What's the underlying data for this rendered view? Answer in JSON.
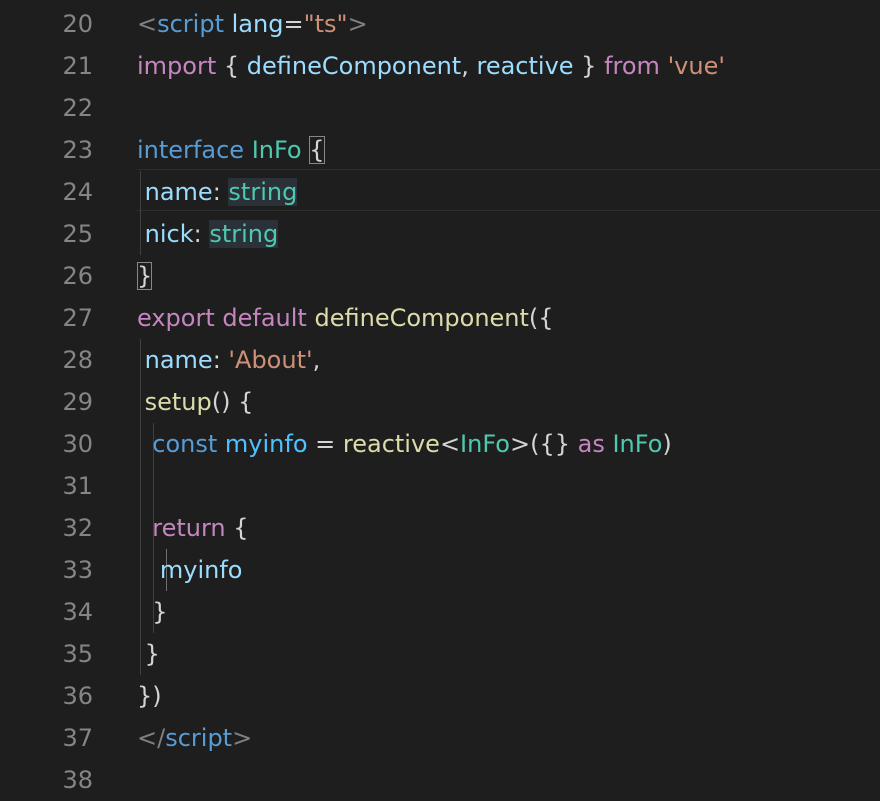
{
  "editor": {
    "lines": [
      {
        "n": "20",
        "tokens": [
          {
            "t": "<",
            "c": "#808080"
          },
          {
            "t": "script",
            "c": "#569cd6"
          },
          {
            "t": " ",
            "c": "#d4d4d4"
          },
          {
            "t": "lang",
            "c": "#9cdcfe"
          },
          {
            "t": "=",
            "c": "#d4d4d4"
          },
          {
            "t": "\"ts\"",
            "c": "#ce9178"
          },
          {
            "t": ">",
            "c": "#808080"
          }
        ]
      },
      {
        "n": "21",
        "tokens": [
          {
            "t": "import",
            "c": "#c586c0"
          },
          {
            "t": " { ",
            "c": "#d4d4d4"
          },
          {
            "t": "defineComponent",
            "c": "#9cdcfe"
          },
          {
            "t": ", ",
            "c": "#d4d4d4"
          },
          {
            "t": "reactive",
            "c": "#9cdcfe"
          },
          {
            "t": " } ",
            "c": "#d4d4d4"
          },
          {
            "t": "from",
            "c": "#c586c0"
          },
          {
            "t": " ",
            "c": "#d4d4d4"
          },
          {
            "t": "'vue'",
            "c": "#ce9178"
          }
        ]
      },
      {
        "n": "22",
        "tokens": []
      },
      {
        "n": "23",
        "tokens": [
          {
            "t": "interface",
            "c": "#569cd6"
          },
          {
            "t": " ",
            "c": "#d4d4d4"
          },
          {
            "t": "InFo",
            "c": "#4ec9b0"
          },
          {
            "t": " ",
            "c": "#d4d4d4"
          },
          {
            "t": "{",
            "c": "#d4d4d4",
            "box": true
          }
        ]
      },
      {
        "n": "24",
        "tokens": [
          {
            "t": " name",
            "c": "#9cdcfe"
          },
          {
            "t": ": ",
            "c": "#d4d4d4"
          },
          {
            "t": "string",
            "c": "#4ec9b0",
            "hl": true
          }
        ]
      },
      {
        "n": "25",
        "tokens": [
          {
            "t": " nick",
            "c": "#9cdcfe"
          },
          {
            "t": ": ",
            "c": "#d4d4d4"
          },
          {
            "t": "string",
            "c": "#4ec9b0",
            "hl": true
          }
        ]
      },
      {
        "n": "26",
        "tokens": [
          {
            "t": "}",
            "c": "#d4d4d4",
            "box": true
          }
        ]
      },
      {
        "n": "27",
        "tokens": [
          {
            "t": "export",
            "c": "#c586c0"
          },
          {
            "t": " ",
            "c": "#d4d4d4"
          },
          {
            "t": "default",
            "c": "#c586c0"
          },
          {
            "t": " ",
            "c": "#d4d4d4"
          },
          {
            "t": "defineComponent",
            "c": "#dcdcaa"
          },
          {
            "t": "({",
            "c": "#d4d4d4"
          }
        ]
      },
      {
        "n": "28",
        "tokens": [
          {
            "t": " name",
            "c": "#9cdcfe"
          },
          {
            "t": ": ",
            "c": "#d4d4d4"
          },
          {
            "t": "'About'",
            "c": "#ce9178"
          },
          {
            "t": ",",
            "c": "#d4d4d4"
          }
        ]
      },
      {
        "n": "29",
        "tokens": [
          {
            "t": " setup",
            "c": "#dcdcaa"
          },
          {
            "t": "() {",
            "c": "#d4d4d4"
          }
        ]
      },
      {
        "n": "30",
        "tokens": [
          {
            "t": "  const",
            "c": "#569cd6"
          },
          {
            "t": " ",
            "c": "#d4d4d4"
          },
          {
            "t": "myinfo",
            "c": "#4fc1ff"
          },
          {
            "t": " = ",
            "c": "#d4d4d4"
          },
          {
            "t": "reactive",
            "c": "#dcdcaa"
          },
          {
            "t": "<",
            "c": "#d4d4d4"
          },
          {
            "t": "InFo",
            "c": "#4ec9b0"
          },
          {
            "t": ">({} ",
            "c": "#d4d4d4"
          },
          {
            "t": "as",
            "c": "#c586c0"
          },
          {
            "t": " ",
            "c": "#d4d4d4"
          },
          {
            "t": "InFo",
            "c": "#4ec9b0"
          },
          {
            "t": ")",
            "c": "#d4d4d4"
          }
        ]
      },
      {
        "n": "31",
        "tokens": []
      },
      {
        "n": "32",
        "tokens": [
          {
            "t": "  return",
            "c": "#c586c0"
          },
          {
            "t": " {",
            "c": "#d4d4d4"
          }
        ]
      },
      {
        "n": "33",
        "tokens": [
          {
            "t": "   myinfo",
            "c": "#9cdcfe"
          }
        ]
      },
      {
        "n": "34",
        "tokens": [
          {
            "t": "  }",
            "c": "#d4d4d4"
          }
        ]
      },
      {
        "n": "35",
        "tokens": [
          {
            "t": " }",
            "c": "#d4d4d4"
          }
        ]
      },
      {
        "n": "36",
        "tokens": [
          {
            "t": "})",
            "c": "#d4d4d4"
          }
        ]
      },
      {
        "n": "37",
        "tokens": [
          {
            "t": "</",
            "c": "#808080"
          },
          {
            "t": "script",
            "c": "#569cd6"
          },
          {
            "t": ">",
            "c": "#808080"
          }
        ]
      },
      {
        "n": "38",
        "tokens": []
      }
    ]
  }
}
